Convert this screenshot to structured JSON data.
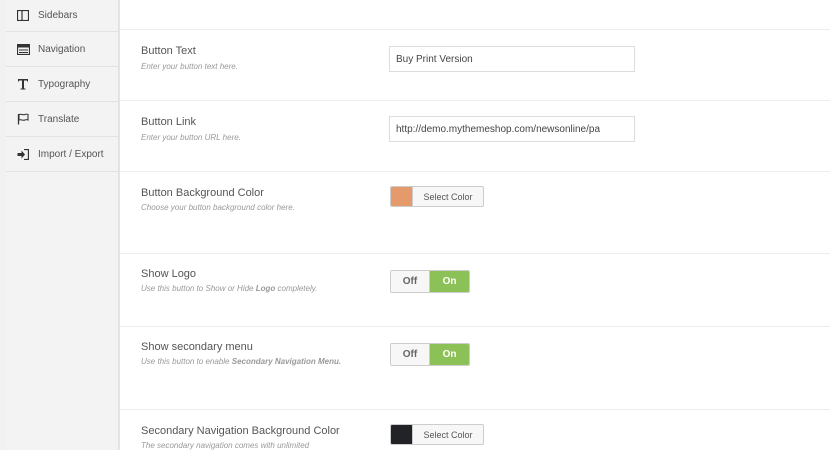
{
  "sidebar": {
    "items": [
      {
        "label": "Sidebars",
        "icon": "columns-icon"
      },
      {
        "label": "Navigation",
        "icon": "list-icon"
      },
      {
        "label": "Typography",
        "icon": "text-icon"
      },
      {
        "label": "Translate",
        "icon": "flag-icon"
      },
      {
        "label": "Import / Export",
        "icon": "sign-in-icon"
      }
    ]
  },
  "options": {
    "button_text": {
      "label": "Button Text",
      "desc": "Enter your button text here.",
      "value": "Buy Print Version"
    },
    "button_link": {
      "label": "Button Link",
      "desc": "Enter your button URL here.",
      "value": "http://demo.mythemeshop.com/newsonline/pa"
    },
    "button_bg_color": {
      "label": "Button Background Color",
      "desc": "Choose your button background color here.",
      "swatch": "#e49a6b",
      "button_label": "Select Color"
    },
    "show_logo": {
      "label": "Show Logo",
      "desc_pre": "Use this button to Show or Hide ",
      "desc_bold": "Logo",
      "desc_post": " completely.",
      "off_label": "Off",
      "on_label": "On",
      "state": "On"
    },
    "show_secondary_menu": {
      "label": "Show secondary menu",
      "desc_pre": "Use this button to enable ",
      "desc_bold": "Secondary Navigation Menu.",
      "off_label": "Off",
      "on_label": "On",
      "state": "On"
    },
    "secondary_nav_bg_color": {
      "label": "Secondary Navigation Background Color",
      "desc": "The secondary navigation comes with unlimited",
      "swatch": "#222326",
      "button_label": "Select Color"
    }
  },
  "colors": {
    "toggle_on": "#8cc158",
    "sidebar_bg": "#f3f3f3"
  }
}
